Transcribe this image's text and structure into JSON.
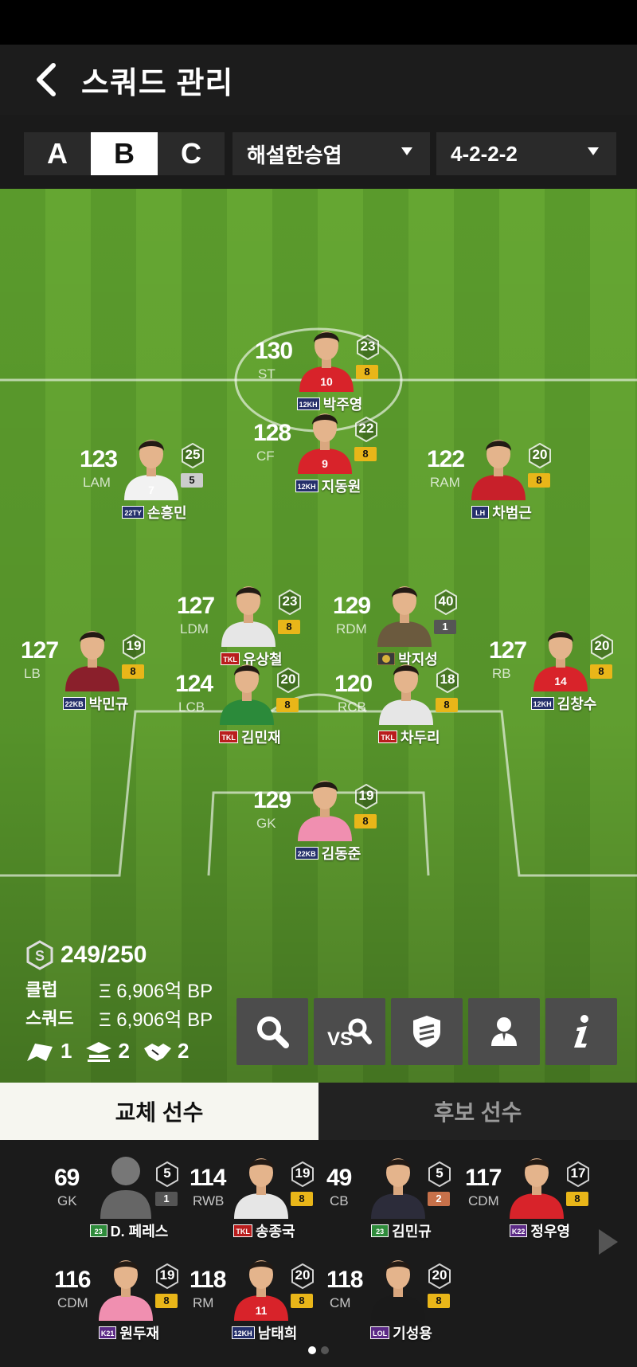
{
  "header": {
    "title": "스쿼드 관리"
  },
  "squad_tabs": [
    "A",
    "B",
    "C"
  ],
  "active_squad": "B",
  "manager_dropdown": "해설한승엽",
  "formation_dropdown": "4-2-2-2",
  "players": [
    {
      "id": "st",
      "ovr": "130",
      "pos": "ST",
      "grade": "23",
      "level": "8",
      "level_style": "gold",
      "season": "12KH",
      "name": "박주영",
      "kit": "#d8232a",
      "num": "10"
    },
    {
      "id": "cf",
      "ovr": "128",
      "pos": "CF",
      "grade": "22",
      "level": "8",
      "level_style": "gold",
      "season": "12KH",
      "name": "지동원",
      "kit": "#d8232a",
      "num": "9"
    },
    {
      "id": "lam",
      "ovr": "123",
      "pos": "LAM",
      "grade": "25",
      "level": "5",
      "level_style": "grey",
      "season": "22TY",
      "name": "손흥민",
      "kit": "#f2f2f2",
      "num": "7"
    },
    {
      "id": "ram",
      "ovr": "122",
      "pos": "RAM",
      "grade": "20",
      "level": "8",
      "level_style": "gold",
      "season": "LH",
      "name": "차범근",
      "kit": "#c8202a",
      "num": ""
    },
    {
      "id": "ldm",
      "ovr": "127",
      "pos": "LDM",
      "grade": "23",
      "level": "8",
      "level_style": "gold",
      "season": "TKL",
      "name": "유상철",
      "kit": "#e6e6e6",
      "num": ""
    },
    {
      "id": "rdm",
      "ovr": "129",
      "pos": "RDM",
      "grade": "40",
      "level": "1",
      "level_style": "dark",
      "season": "ICON",
      "name": "박지성",
      "kit": "#6b5a3e",
      "num": ""
    },
    {
      "id": "lb",
      "ovr": "127",
      "pos": "LB",
      "grade": "19",
      "level": "8",
      "level_style": "gold",
      "season": "22KB",
      "name": "박민규",
      "kit": "#8a1f2b",
      "num": ""
    },
    {
      "id": "lcb",
      "ovr": "124",
      "pos": "LCB",
      "grade": "20",
      "level": "8",
      "level_style": "gold",
      "season": "TKL",
      "name": "김민재",
      "kit": "#2b8a3a",
      "num": ""
    },
    {
      "id": "rcb",
      "ovr": "120",
      "pos": "RCB",
      "grade": "18",
      "level": "8",
      "level_style": "gold",
      "season": "TKL",
      "name": "차두리",
      "kit": "#e6e6e6",
      "num": ""
    },
    {
      "id": "rb",
      "ovr": "127",
      "pos": "RB",
      "grade": "20",
      "level": "8",
      "level_style": "gold",
      "season": "12KH",
      "name": "김창수",
      "kit": "#d8232a",
      "num": "14"
    },
    {
      "id": "gk",
      "ovr": "129",
      "pos": "GK",
      "grade": "19",
      "level": "8",
      "level_style": "gold",
      "season": "22KB",
      "name": "김동준",
      "kit": "#f08fb0",
      "num": ""
    }
  ],
  "stats": {
    "salary": "249/250",
    "club_label": "클럽",
    "club_value": "Ξ 6,906억 BP",
    "squad_label": "스쿼드",
    "squad_value": "Ξ 6,906억 BP",
    "chem_flag": "1",
    "chem_team": "2",
    "chem_handshake": "2"
  },
  "tools": [
    "search-icon",
    "vs-search-icon",
    "tactics-shield-icon",
    "coach-icon",
    "info-icon"
  ],
  "bench_tabs": {
    "active": "교체 선수",
    "inactive": "후보 선수"
  },
  "bench_players": [
    {
      "id": "b1",
      "ovr": "69",
      "pos": "GK",
      "grade": "5",
      "level": "1",
      "level_style": "dark",
      "season": "23",
      "season_style": "green",
      "name": "D. 페레스",
      "kit": "silhouette",
      "num": ""
    },
    {
      "id": "b2",
      "ovr": "114",
      "pos": "RWB",
      "grade": "19",
      "level": "8",
      "level_style": "gold",
      "season": "TKL",
      "season_style": "red",
      "name": "송종국",
      "kit": "#e6e6e6",
      "num": ""
    },
    {
      "id": "b3",
      "ovr": "49",
      "pos": "CB",
      "grade": "5",
      "level": "2",
      "level_style": "bronze",
      "season": "23",
      "season_style": "green",
      "name": "김민규",
      "kit": "#2c2c3a",
      "num": ""
    },
    {
      "id": "b4",
      "ovr": "117",
      "pos": "CDM",
      "grade": "17",
      "level": "8",
      "level_style": "gold",
      "season": "K22",
      "season_style": "purple",
      "name": "정우영",
      "kit": "#d8232a",
      "num": ""
    },
    {
      "id": "b5",
      "ovr": "116",
      "pos": "CDM",
      "grade": "19",
      "level": "8",
      "level_style": "gold",
      "season": "K21",
      "season_style": "purple",
      "name": "원두재",
      "kit": "#f08fb0",
      "num": ""
    },
    {
      "id": "b6",
      "ovr": "118",
      "pos": "RM",
      "grade": "20",
      "level": "8",
      "level_style": "gold",
      "season": "12KH",
      "season_style": "navy",
      "name": "남태희",
      "kit": "#d8232a",
      "num": "11"
    },
    {
      "id": "b7",
      "ovr": "118",
      "pos": "CM",
      "grade": "20",
      "level": "8",
      "level_style": "gold",
      "season": "LOL",
      "season_style": "purple",
      "name": "기성용",
      "kit": "#1a1a1a",
      "num": ""
    }
  ]
}
